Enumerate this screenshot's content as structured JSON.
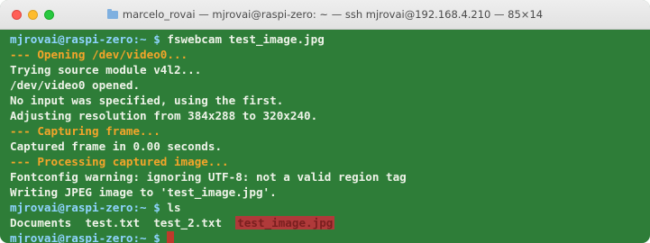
{
  "window": {
    "title": "marcelo_rovai — mjrovai@raspi-zero: ~ — ssh mjrovai@192.168.4.210 — 85×14",
    "traffic_lights": [
      "close",
      "minimize",
      "zoom"
    ]
  },
  "colors": {
    "background": "#2e7d38",
    "prompt": "#8fd4ff",
    "highlight_text": "#f4a52a",
    "normal_text": "#eef3e8",
    "file_highlight_bg": "#b03a3a"
  },
  "lines": [
    {
      "prompt": "mjrovai@raspi-zero:~ $ ",
      "text": "fswebcam test_image.jpg"
    },
    {
      "text": "--- Opening /dev/video0...",
      "style": "orange"
    },
    {
      "text": "Trying source module v4l2..."
    },
    {
      "text": "/dev/video0 opened."
    },
    {
      "text": "No input was specified, using the first."
    },
    {
      "text": "Adjusting resolution from 384x288 to 320x240."
    },
    {
      "text": "--- Capturing frame...",
      "style": "orange"
    },
    {
      "text": "Captured frame in 0.00 seconds."
    },
    {
      "text": "--- Processing captured image...",
      "style": "orange"
    },
    {
      "text": "Fontconfig warning: ignoring UTF-8: not a valid region tag"
    },
    {
      "text": "Writing JPEG image to 'test_image.jpg'."
    },
    {
      "prompt": "mjrovai@raspi-zero:~ $ ",
      "text": "ls"
    },
    {
      "text": "Documents  test.txt  test_2.txt  ",
      "highlight": "test_image.jpg"
    },
    {
      "prompt": "mjrovai@raspi-zero:~ $ ",
      "text": "",
      "cursor": true
    }
  ]
}
